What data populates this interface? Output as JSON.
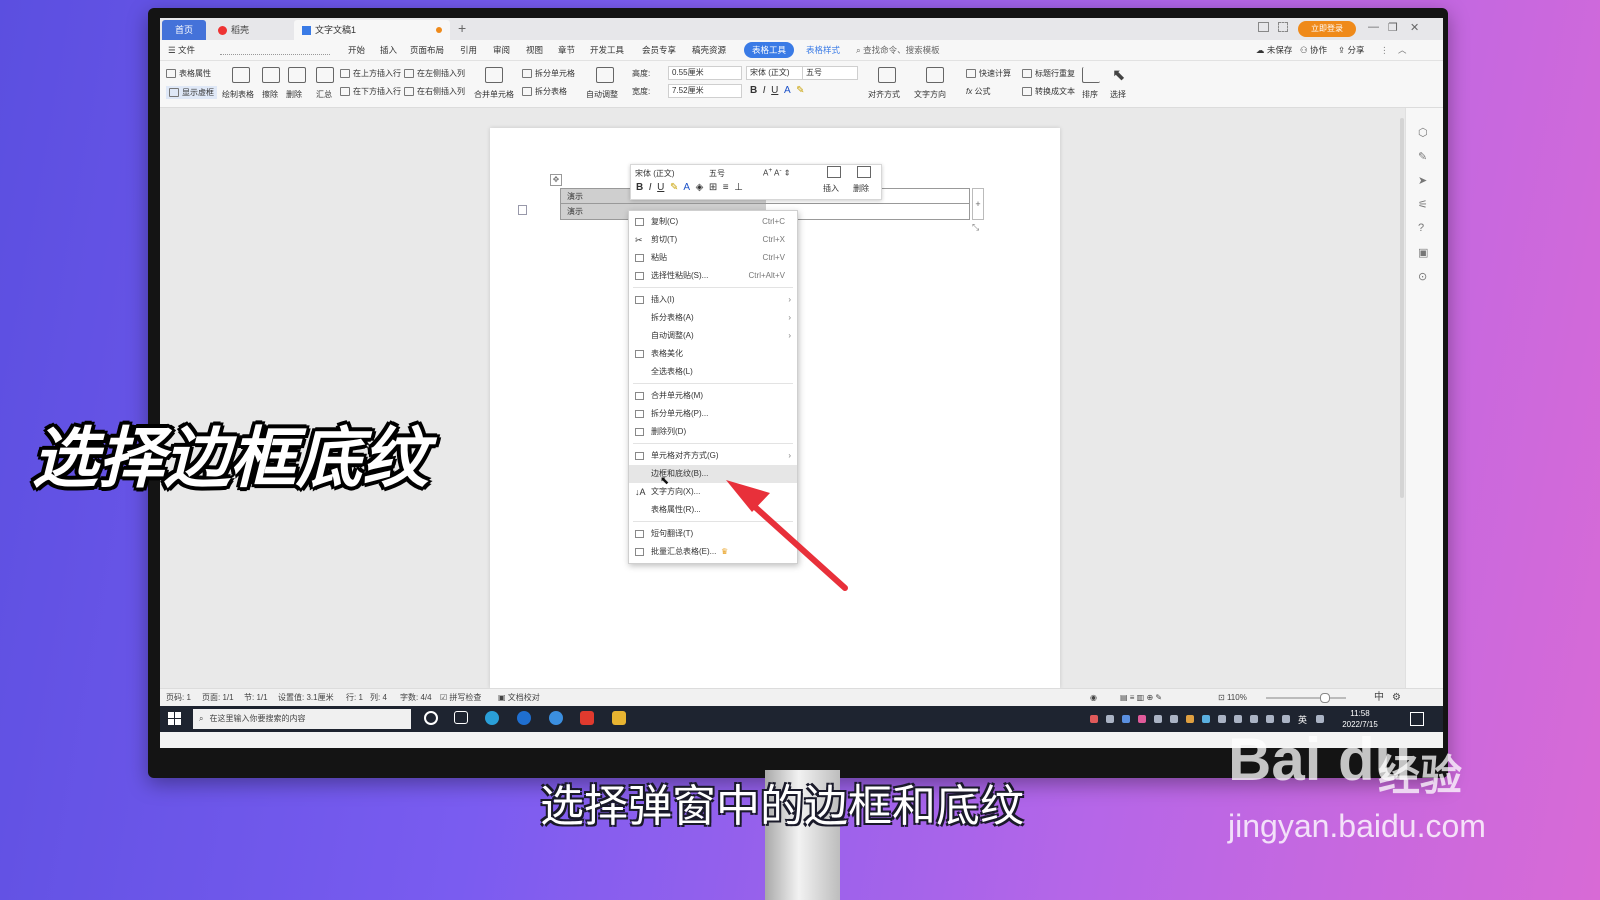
{
  "tabs": {
    "home": "首页",
    "shell": "稻壳",
    "doc": "文字文稿1",
    "login": "立即登录"
  },
  "menu": {
    "file": "文件",
    "items": [
      "开始",
      "插入",
      "页面布局",
      "引用",
      "审阅",
      "视图",
      "章节",
      "开发工具",
      "会员专享",
      "稿壳资源"
    ],
    "table_tools": "表格工具",
    "table_style": "表格样式",
    "search": "查找命令、搜索模板",
    "unsaved": "未保存",
    "collab": "协作",
    "share": "分享"
  },
  "ribbon": {
    "table_props": "表格属性",
    "show_grid": "显示虚框",
    "draw_table": "绘制表格",
    "erase": "擦除",
    "delete": "删除",
    "summary": "汇总",
    "insert_above": "在上方插入行",
    "insert_below": "在下方插入行",
    "insert_left": "在左侧插入列",
    "insert_right": "在右侧插入列",
    "merge": "合并单元格",
    "split_cells": "拆分单元格",
    "split_table": "拆分表格",
    "auto_fit": "自动调整",
    "height_label": "高度:",
    "height_val": "0.55厘米",
    "width_label": "宽度:",
    "width_val": "7.52厘米",
    "font": "宋体 (正文)",
    "size": "五号",
    "align": "对齐方式",
    "text_dir": "文字方向",
    "quick_calc": "快速计算",
    "title_repeat": "标题行重复",
    "formula": "公式",
    "to_text": "转换成文本",
    "sort": "排序",
    "select": "选择"
  },
  "table": {
    "cell1": "演示",
    "cell2": "演示"
  },
  "minitb": {
    "font": "宋体 (正文)",
    "size": "五号",
    "insert": "插入",
    "delete": "删除"
  },
  "context_menu": [
    {
      "label": "复制(C)",
      "key": "Ctrl+C"
    },
    {
      "label": "剪切(T)",
      "key": "Ctrl+X"
    },
    {
      "label": "粘贴",
      "key": "Ctrl+V"
    },
    {
      "label": "选择性粘贴(S)...",
      "key": "Ctrl+Alt+V"
    },
    {
      "label": "插入(I)",
      "key": ""
    },
    {
      "label": "拆分表格(A)",
      "key": ""
    },
    {
      "label": "自动调整(A)",
      "key": ""
    },
    {
      "label": "表格美化",
      "key": ""
    },
    {
      "label": "全选表格(L)",
      "key": ""
    },
    {
      "label": "合并单元格(M)",
      "key": ""
    },
    {
      "label": "拆分单元格(P)...",
      "key": ""
    },
    {
      "label": "删除列(D)",
      "key": ""
    },
    {
      "label": "单元格对齐方式(G)",
      "key": ""
    },
    {
      "label": "边框和底纹(B)...",
      "key": ""
    },
    {
      "label": "文字方向(X)...",
      "key": ""
    },
    {
      "label": "表格属性(R)...",
      "key": ""
    },
    {
      "label": "短句翻译(T)",
      "key": ""
    },
    {
      "label": "批量汇总表格(E)...",
      "key": ""
    }
  ],
  "status": {
    "page_no": "页码: 1",
    "pages": "页面: 1/1",
    "section": "节: 1/1",
    "setting": "设置值: 3.1厘米",
    "row": "行: 1",
    "col": "列: 4",
    "words": "字数: 4/4",
    "spell": "拼写检查",
    "proof": "文档校对",
    "zoom": "110%",
    "ime": "中"
  },
  "taskbar": {
    "search_placeholder": "在这里输入你要搜索的内容",
    "time": "11:58",
    "date": "2022/7/15",
    "lang": "英"
  },
  "captions": {
    "big": "选择边框底纹",
    "subtitle": "选择弹窗中的边框和底纹",
    "wm_logo": "Bai du",
    "wm_cn": "经验",
    "wm_url": "jingyan.baidu.com"
  },
  "colors": {
    "accent": "#3a7be6",
    "arrow": "#e8303a",
    "highlight": "#e6e6e6"
  }
}
